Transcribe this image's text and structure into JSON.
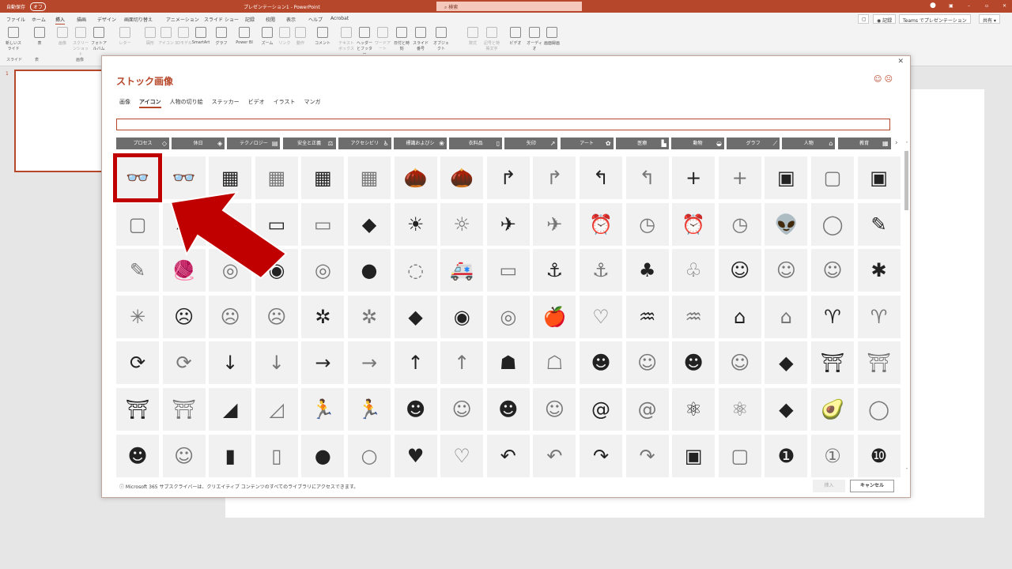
{
  "titlebar": {
    "autosave": "自動保存",
    "autosave_state": "オフ",
    "title": "プレゼンテーション1 - PowerPoint",
    "search_placeholder": "検索"
  },
  "menu": [
    "ファイル",
    "ホーム",
    "挿入",
    "描画",
    "デザイン",
    "画面切り替え",
    "アニメーション",
    "スライド ショー",
    "記録",
    "校閲",
    "表示",
    "ヘルプ",
    "Acrobat"
  ],
  "topbuttons": {
    "record": "記録",
    "teams": "Teams でプレゼンテーション",
    "share": "共有"
  },
  "ribbon": {
    "buttons": [
      "新しいスライド",
      "表",
      "画像",
      "スクリーンショット",
      "フォトアルバム",
      "レター",
      "図形",
      "アイコン",
      "3Dモデル",
      "SmartArt",
      "グラフ",
      "Power BI",
      "ズーム",
      "リンク",
      "動作",
      "コメント",
      "テキストボックス",
      "ヘッダーとフッター",
      "ワードアート",
      "日付と時刻",
      "スライド番号",
      "オブジェクト",
      "数式",
      "記号と特殊文字",
      "ビデオ",
      "オーディオ",
      "画面録画"
    ],
    "groups": [
      "スライド",
      "表",
      "画像"
    ]
  },
  "slide_panel": {
    "number": "1"
  },
  "dialog": {
    "title": "ストック画像",
    "tabs": [
      "画像",
      "アイコン",
      "人物の切り絵",
      "ステッカー",
      "ビデオ",
      "イラスト",
      "マンガ"
    ],
    "active_tab": "アイコン",
    "search_value": "",
    "categories": [
      "プロセス",
      "休日",
      "テクノロジー",
      "安全と正義",
      "アクセシビリ",
      "標識およびシ",
      "衣料品",
      "矢印",
      "アート",
      "医療",
      "動物",
      "グラフ",
      "人物",
      "教育"
    ],
    "footer_note": "Microsoft 365 サブスクライバーは、クリエイティブ コンテンツのすべてのライブラリにアクセスできます。",
    "insert_label": "挿入",
    "cancel_label": "キャンセル",
    "icons": [
      [
        "3d-glasses",
        "👓",
        1
      ],
      [
        "3d-glasses-outline",
        "👓",
        0
      ],
      [
        "abacus",
        "▦",
        1
      ],
      [
        "abacus-outline",
        "▦",
        0
      ],
      [
        "abacus-2",
        "▦",
        1
      ],
      [
        "abacus-2-outline",
        "▦",
        0
      ],
      [
        "acorn",
        "🌰",
        1
      ],
      [
        "acorn-outline",
        "🌰",
        0
      ],
      [
        "arrow-curve-right",
        "↱",
        1
      ],
      [
        "arrow-curve-right-outline",
        "↱",
        0
      ],
      [
        "arrow-curve-left",
        "↰",
        1
      ],
      [
        "arrow-curve-left-outline",
        "↰",
        0
      ],
      [
        "plus",
        "+",
        1
      ],
      [
        "plus-outline",
        "+",
        0
      ],
      [
        "address-book",
        "▣",
        1
      ],
      [
        "address-book-outline",
        "▢",
        0
      ],
      [
        "address-book-2",
        "▣",
        1
      ],
      [
        "address-book-outline-2",
        "▢",
        0
      ],
      [
        "bandage",
        "▰",
        1
      ],
      [
        "bandage-outline",
        "▱",
        0
      ],
      [
        "billboard",
        "▭",
        1
      ],
      [
        "billboard-outline",
        "▭",
        0
      ],
      [
        "africa",
        "◆",
        1
      ],
      [
        "agriculture",
        "☀",
        1
      ],
      [
        "agriculture-outline",
        "☼",
        0
      ],
      [
        "airplane",
        "✈",
        1
      ],
      [
        "airplane-outline",
        "✈",
        0
      ],
      [
        "alarm-clock",
        "⏰",
        1
      ],
      [
        "alarm-clock-outline",
        "◷",
        0
      ],
      [
        "alarm-ringing",
        "⏰",
        1
      ],
      [
        "alarm-ringing-outline",
        "◷",
        0
      ],
      [
        "alien",
        "👽",
        1
      ],
      [
        "alien-outline",
        "◯",
        0
      ],
      [
        "needle",
        "✎",
        1
      ],
      [
        "needle-outline",
        "✎",
        0
      ],
      [
        "yarn",
        "🧶",
        1
      ],
      [
        "yarn-outline",
        "◎",
        0
      ],
      [
        "measuring-tape",
        "◉",
        1
      ],
      [
        "measuring-tape-outline",
        "◎",
        0
      ],
      [
        "button",
        "●",
        1
      ],
      [
        "button-outline",
        "◌",
        0
      ],
      [
        "ambulance",
        "🚑",
        1
      ],
      [
        "ambulance-outline",
        "▭",
        0
      ],
      [
        "anchor",
        "⚓",
        1
      ],
      [
        "anchor-outline",
        "⚓",
        0
      ],
      [
        "coral",
        "♣",
        1
      ],
      [
        "coral-outline",
        "♧",
        0
      ],
      [
        "angel-face",
        "☺",
        1
      ],
      [
        "angel-face-outline",
        "☺",
        0
      ],
      [
        "angel-face-outline-2",
        "☺",
        0
      ],
      [
        "anger-symbol",
        "✱",
        1
      ],
      [
        "anger-symbol-outline",
        "✳",
        0
      ],
      [
        "angry-face",
        "☹",
        1
      ],
      [
        "frown-face-outline",
        "☹",
        0
      ],
      [
        "confused-face",
        "☹",
        0
      ],
      [
        "ant",
        "✲",
        1
      ],
      [
        "ant-outline",
        "✲",
        0
      ],
      [
        "antarctica",
        "◆",
        1
      ],
      [
        "aperture",
        "◉",
        1
      ],
      [
        "aperture-outline",
        "◎",
        0
      ],
      [
        "apple",
        "🍎",
        1
      ],
      [
        "apple-outline",
        "♡",
        0
      ],
      [
        "aquarius",
        "♒",
        1
      ],
      [
        "aquarius-outline",
        "♒",
        0
      ],
      [
        "architecture",
        "⌂",
        1
      ],
      [
        "architecture-outline",
        "⌂",
        0
      ],
      [
        "aries",
        "♈",
        1
      ],
      [
        "aries-outline",
        "♈",
        0
      ],
      [
        "refresh",
        "⟳",
        1
      ],
      [
        "refresh-outline",
        "⟳",
        0
      ],
      [
        "arrow-down",
        "↓",
        1
      ],
      [
        "arrow-down-thin",
        "↓",
        0
      ],
      [
        "arrow-right",
        "→",
        1
      ],
      [
        "arrow-right-thin",
        "→",
        0
      ],
      [
        "arrow-up",
        "↑",
        1
      ],
      [
        "arrow-up-thin",
        "↑",
        0
      ],
      [
        "head-brain",
        "☗",
        1
      ],
      [
        "head-brain-outline",
        "☖",
        0
      ],
      [
        "artist",
        "☻",
        1
      ],
      [
        "artist-outline",
        "☺",
        0
      ],
      [
        "artist-2",
        "☻",
        1
      ],
      [
        "artist-2-outline",
        "☺",
        0
      ],
      [
        "asia",
        "◆",
        1
      ],
      [
        "pagoda",
        "⛩",
        1
      ],
      [
        "pagoda-outline",
        "⛩",
        0
      ],
      [
        "gate",
        "⛩",
        1
      ],
      [
        "gate-outline",
        "⛩",
        0
      ],
      [
        "climber",
        "◢",
        1
      ],
      [
        "climber-outline",
        "◿",
        0
      ],
      [
        "athlete",
        "🏃",
        1
      ],
      [
        "athlete-outline",
        "🏃",
        0
      ],
      [
        "astronaut",
        "☻",
        1
      ],
      [
        "astronaut-outline",
        "☺",
        0
      ],
      [
        "astronaut-2",
        "☻",
        1
      ],
      [
        "astronaut-2-outline",
        "☺",
        0
      ],
      [
        "at-sign",
        "@",
        1
      ],
      [
        "at-sign-outline",
        "@",
        0
      ],
      [
        "atom",
        "⚛",
        1
      ],
      [
        "atom-outline",
        "⚛",
        0
      ],
      [
        "australia",
        "◆",
        1
      ],
      [
        "avocado",
        "🥑",
        1
      ],
      [
        "avocado-outline",
        "◯",
        0
      ],
      [
        "baby",
        "☻",
        1
      ],
      [
        "baby-outline",
        "☺",
        0
      ],
      [
        "baby-bottle",
        "▮",
        1
      ],
      [
        "baby-bottle-outline",
        "▯",
        0
      ],
      [
        "crawling-baby",
        "●",
        1
      ],
      [
        "crawling-baby-outline",
        "○",
        0
      ],
      [
        "onesie",
        "♥",
        1
      ],
      [
        "onesie-outline",
        "♡",
        0
      ],
      [
        "reply",
        "↶",
        1
      ],
      [
        "reply-outline",
        "↶",
        0
      ],
      [
        "forward",
        "↷",
        1
      ],
      [
        "forward-outline",
        "↷",
        0
      ],
      [
        "backpack",
        "▣",
        1
      ],
      [
        "backpack-outline",
        "▢",
        0
      ],
      [
        "number-1",
        "❶",
        1
      ],
      [
        "number-1-outline",
        "①",
        0
      ],
      [
        "number-10",
        "❿",
        1
      ]
    ]
  },
  "colors": {
    "accent": "#b7472a",
    "highlight": "#c00000"
  }
}
